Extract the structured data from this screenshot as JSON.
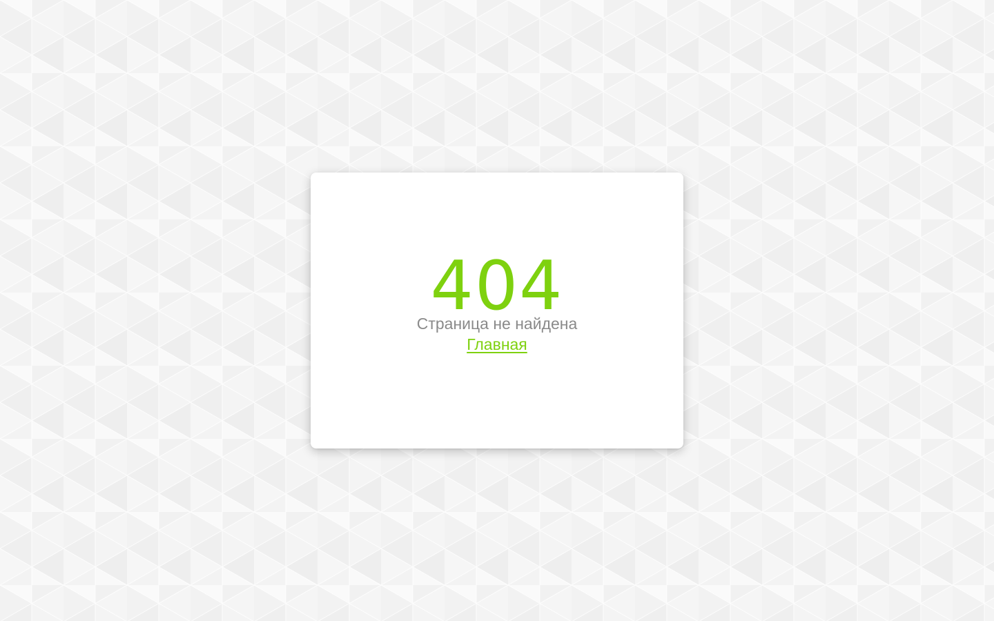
{
  "colors": {
    "background": "#f8f8f8",
    "pattern_light": "#f0f0f0",
    "pattern_mid": "#e8e8e8",
    "card_background": "#ffffff",
    "accent": "#7ed10f",
    "subtitle_text": "#8a8a8a"
  },
  "error": {
    "code": "404",
    "message": "Страница не найдена",
    "home_link_label": "Главная"
  }
}
